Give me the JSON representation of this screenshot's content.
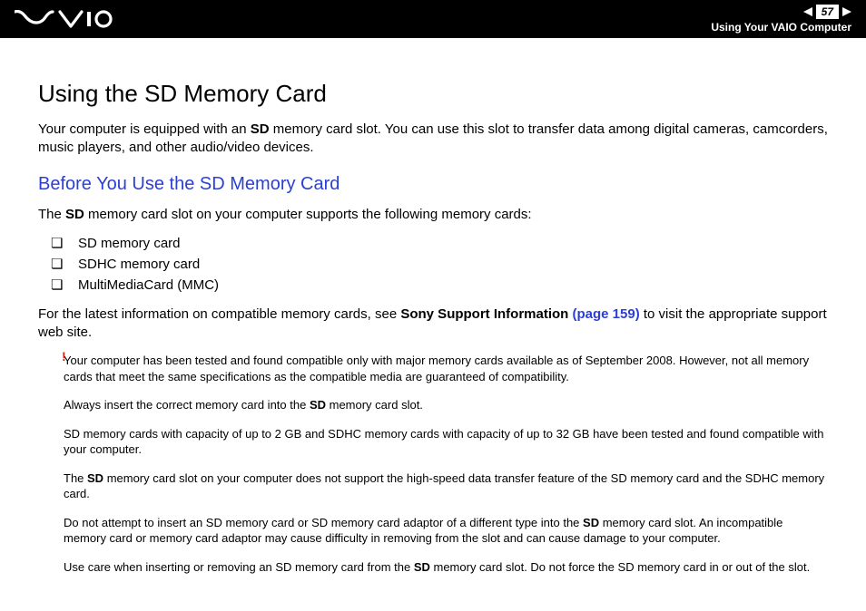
{
  "header": {
    "page_number": "57",
    "breadcrumb": "Using Your VAIO Computer"
  },
  "heading": "Using the SD Memory Card",
  "intro_pre": "Your computer is equipped with an ",
  "intro_bold": "SD",
  "intro_post": " memory card slot. You can use this slot to transfer data among digital cameras, camcorders, music players, and other audio/video devices.",
  "subheading": "Before You Use the SD Memory Card",
  "support_pre": "The ",
  "support_bold": "SD",
  "support_post": " memory card slot on your computer supports the following memory cards:",
  "cards": {
    "item0": "SD memory card",
    "item1": "SDHC memory card",
    "item2": "MultiMediaCard (MMC)"
  },
  "latest_pre": "For the latest information on compatible memory cards, see ",
  "latest_bold": "Sony Support Information ",
  "latest_link": "(page 159)",
  "latest_post": " to visit the appropriate support web site.",
  "bang": "!",
  "notes": {
    "n0": "Your computer has been tested and found compatible only with major memory cards available as of September 2008. However, not all memory cards that meet the same specifications as the compatible media are guaranteed of compatibility.",
    "n1_pre": "Always insert the correct memory card into the ",
    "n1_bold": "SD",
    "n1_post": " memory card slot.",
    "n2": "SD memory cards with capacity of up to 2 GB and SDHC memory cards with capacity of up to 32 GB have been tested and found compatible with your computer.",
    "n3_pre": "The ",
    "n3_bold": "SD",
    "n3_post": " memory card slot on your computer does not support the high-speed data transfer feature of the SD memory card and the SDHC memory card.",
    "n4_pre": "Do not attempt to insert an SD memory card or SD memory card adaptor of a different type into the ",
    "n4_bold": "SD",
    "n4_post": " memory card slot. An incompatible memory card or memory card adaptor may cause difficulty in removing from the slot and can cause damage to your computer.",
    "n5_pre": "Use care when inserting or removing an SD memory card from the ",
    "n5_bold": "SD",
    "n5_post": " memory card slot. Do not force the SD memory card in or out of the slot."
  }
}
